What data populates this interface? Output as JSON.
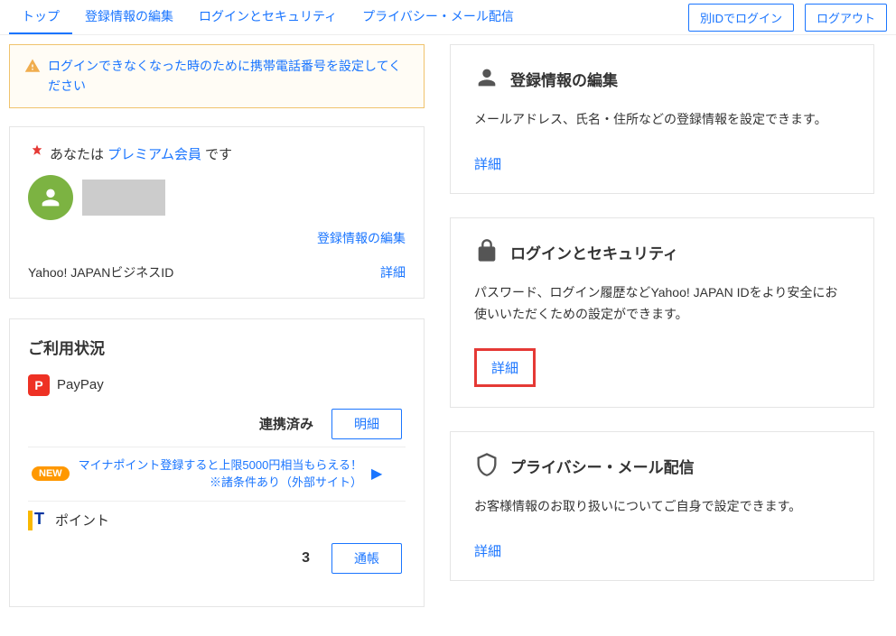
{
  "header": {
    "tabs": [
      "トップ",
      "登録情報の編集",
      "ログインとセキュリティ",
      "プライバシー・メール配信"
    ],
    "login_other": "別IDでログイン",
    "logout": "ログアウト"
  },
  "alert": {
    "text": "ログインできなくなった時のために携帯電話番号を設定してください"
  },
  "premium": {
    "prefix": "あなたは",
    "link": "プレミアム会員",
    "suffix": "です"
  },
  "profile": {
    "edit_link": "登録情報の編集",
    "biz_label": "Yahoo! JAPANビジネスID",
    "detail": "詳細"
  },
  "usage": {
    "title": "ご利用状況",
    "paypay": {
      "name": "PayPay",
      "linked": "連携済み",
      "button": "明細"
    },
    "promo": {
      "badge": "NEW",
      "text": "マイナポイント登録すると上限5000円相当もらえる！",
      "cond": "※諸条件あり（外部サイト）"
    },
    "tpoint": {
      "name": "ポイント",
      "value": "3",
      "button": "通帳"
    }
  },
  "cards": {
    "edit": {
      "title": "登録情報の編集",
      "desc": "メールアドレス、氏名・住所などの登録情報を設定できます。",
      "link": "詳細"
    },
    "security": {
      "title": "ログインとセキュリティ",
      "desc": "パスワード、ログイン履歴などYahoo! JAPAN IDをより安全にお使いいただくための設定ができます。",
      "link": "詳細"
    },
    "privacy": {
      "title": "プライバシー・メール配信",
      "desc": "お客様情報のお取り扱いについてご自身で設定できます。",
      "link": "詳細"
    }
  }
}
